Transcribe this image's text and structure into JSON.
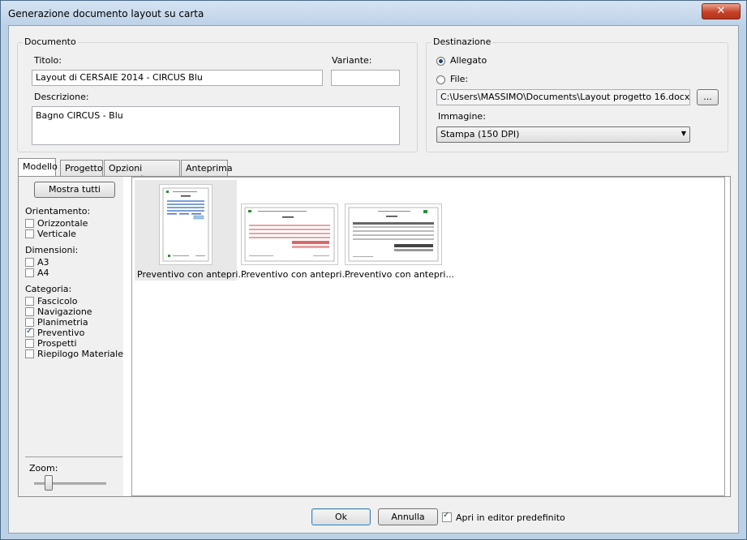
{
  "window": {
    "title": "Generazione documento layout su carta",
    "close_glyph": "✕"
  },
  "documento": {
    "group_label": "Documento",
    "titolo_label": "Titolo:",
    "titolo_value": "Layout di CERSAIE 2014 - CIRCUS Blu",
    "variante_label": "Variante:",
    "variante_value": "",
    "descrizione_label": "Descrizione:",
    "descrizione_value": "Bagno CIRCUS - Blu"
  },
  "destinazione": {
    "group_label": "Destinazione",
    "allegato_label": "Allegato",
    "file_label": "File:",
    "file_path": "C:\\Users\\MASSIMO\\Documents\\Layout progetto 16.docx",
    "browse_label": "...",
    "immagine_label": "Immagine:",
    "immagine_value": "Stampa (150 DPI)",
    "selected": "allegato"
  },
  "tabs": [
    {
      "label": "Modello",
      "active": true
    },
    {
      "label": "Progetto",
      "active": false
    },
    {
      "label": "Opzioni avanzate",
      "active": false
    },
    {
      "label": "Anteprima",
      "active": false
    }
  ],
  "filters": {
    "show_all_label": "Mostra tutti",
    "orientamento_label": "Orientamento:",
    "orientamento": [
      {
        "label": "Orizzontale",
        "checked": false
      },
      {
        "label": "Verticale",
        "checked": false
      }
    ],
    "dimensioni_label": "Dimensioni:",
    "dimensioni": [
      {
        "label": "A3",
        "checked": false
      },
      {
        "label": "A4",
        "checked": false
      }
    ],
    "categoria_label": "Categoria:",
    "categoria": [
      {
        "label": "Fascicolo",
        "checked": false
      },
      {
        "label": "Navigazione",
        "checked": false
      },
      {
        "label": "Planimetria",
        "checked": false
      },
      {
        "label": "Preventivo",
        "checked": true
      },
      {
        "label": "Prospetti",
        "checked": false
      },
      {
        "label": "Riepilogo Materiale",
        "checked": false
      }
    ],
    "zoom_label": "Zoom:",
    "zoom_level": 0.25
  },
  "templates": [
    {
      "label": "Preventivo con antepri...",
      "selected": true,
      "orientation": "portrait"
    },
    {
      "label": "Preventivo con antepri...",
      "selected": false,
      "orientation": "landscape-red"
    },
    {
      "label": "Preventivo con antepri...",
      "selected": false,
      "orientation": "landscape-gray"
    }
  ],
  "footer": {
    "ok_label": "Ok",
    "annulla_label": "Annulla",
    "apri_label": "Apri in editor predefinito",
    "apri_checked": true
  },
  "colors": {
    "title_bar": "#bdd2e8",
    "close_button": "#c6432a",
    "dialog_bg": "#f0f0f0",
    "accent_red": "#e6a0a0"
  }
}
